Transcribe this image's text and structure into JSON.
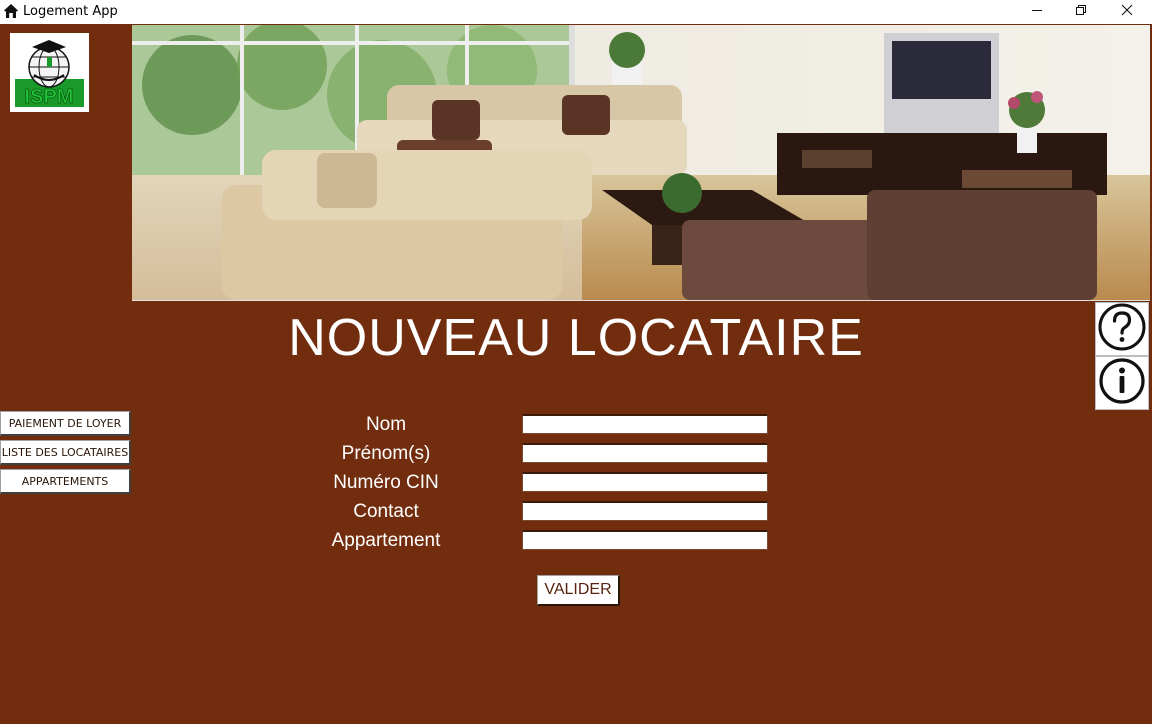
{
  "window": {
    "title": "Logement App",
    "controls": {
      "minimize": "minimize-icon",
      "restore": "restore-icon",
      "close": "close-icon"
    }
  },
  "header": {
    "logo_icon": "school-globe-logo",
    "banner_image": "living-room-photo"
  },
  "page": {
    "title": "NOUVEAU LOCATAIRE"
  },
  "sidebar": {
    "items": [
      {
        "label": "PAIEMENT DE LOYER"
      },
      {
        "label": "LISTE DES LOCATAIRES"
      },
      {
        "label": "APPARTEMENTS"
      }
    ]
  },
  "form": {
    "fields": [
      {
        "label": "Nom",
        "value": ""
      },
      {
        "label": "Prénom(s)",
        "value": ""
      },
      {
        "label": "Numéro CIN",
        "value": ""
      },
      {
        "label": "Contact",
        "value": ""
      },
      {
        "label": "Appartement",
        "value": ""
      }
    ],
    "submit_label": "VALIDER"
  },
  "help": {
    "help_icon": "question-circle-icon",
    "info_icon": "info-circle-icon"
  },
  "colors": {
    "background": "#722d0f",
    "text": "#ffffff",
    "button_text": "#5a2310"
  }
}
